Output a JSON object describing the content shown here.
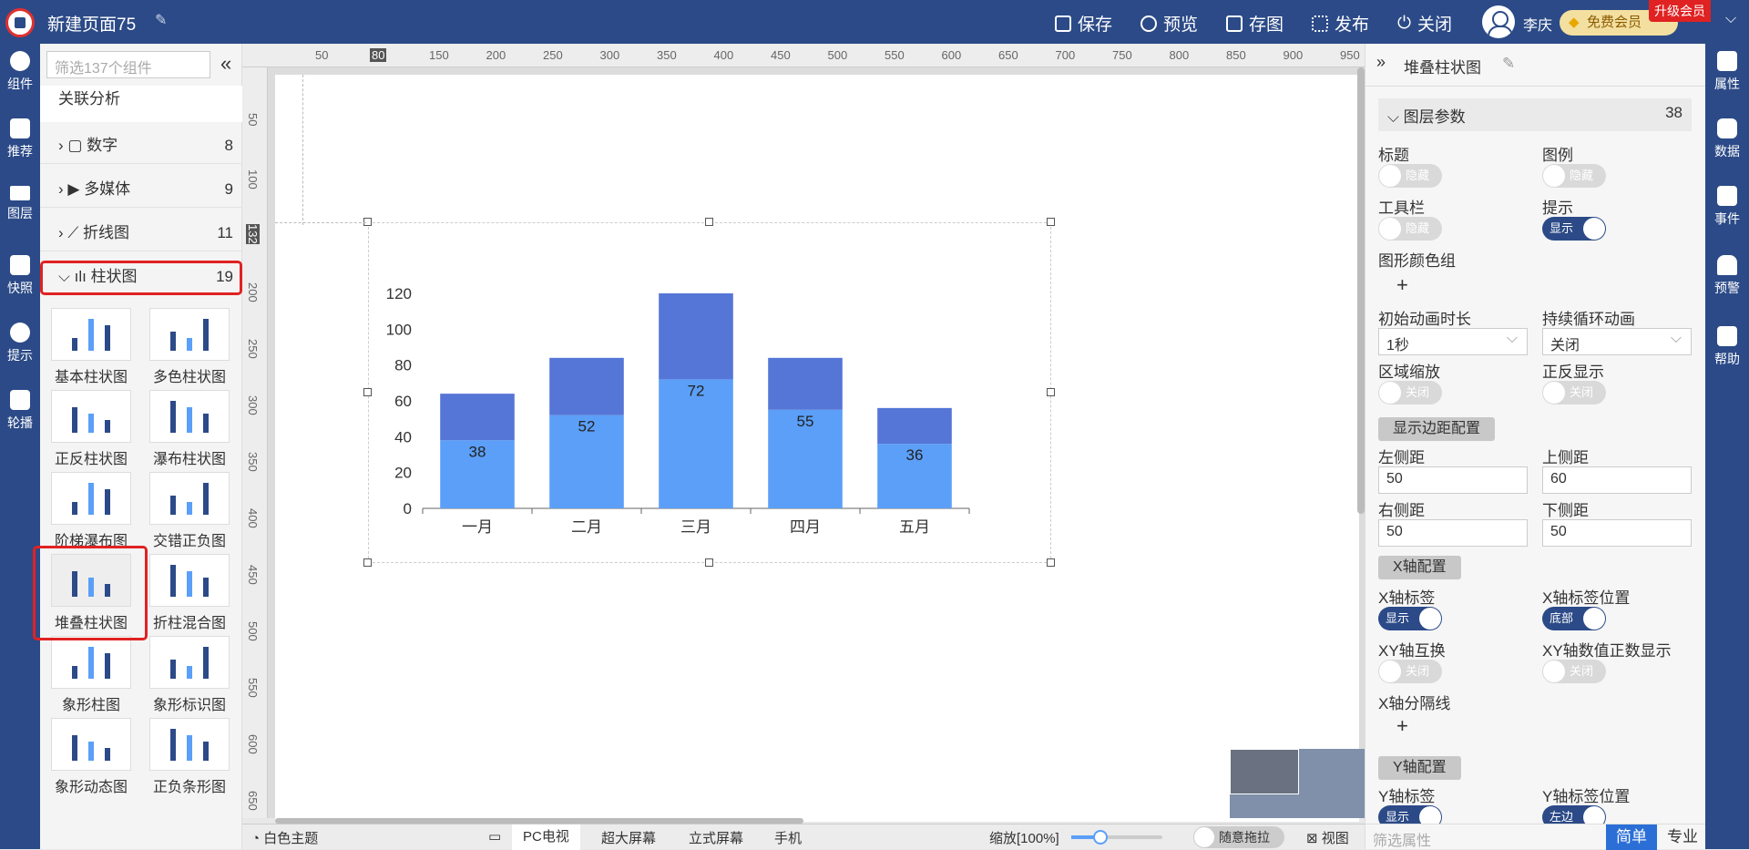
{
  "header": {
    "page_title": "新建页面75",
    "buttons": {
      "save": "保存",
      "preview": "预览",
      "save_image": "存图",
      "publish": "发布",
      "close": "关闭"
    },
    "user_name": "李庆",
    "member_label": "免费会员",
    "upgrade_label": "升级会员"
  },
  "left_nav": {
    "components": "组件",
    "recommend": "推荐",
    "layers": "图层",
    "snapshot": "快照",
    "tips": "提示",
    "carousel": "轮播"
  },
  "component_panel": {
    "search_placeholder": "筛选137个组件",
    "top_item": "关联分析",
    "categories": [
      {
        "label": "数字",
        "count": "8"
      },
      {
        "label": "多媒体",
        "count": "9"
      },
      {
        "label": "折线图",
        "count": "11"
      },
      {
        "label": "柱状图",
        "count": "19"
      }
    ],
    "items": [
      "基本柱状图",
      "多色柱状图",
      "正反柱状图",
      "瀑布柱状图",
      "阶梯瀑布图",
      "交错正负图",
      "堆叠柱状图",
      "折柱混合图",
      "象形柱图",
      "象形标识图",
      "象形动态图",
      "正负条形图"
    ]
  },
  "ruler": {
    "h_ticks": [
      "50",
      "80",
      "150",
      "200",
      "250",
      "300",
      "350",
      "400",
      "450",
      "500",
      "550",
      "600",
      "650",
      "700",
      "750",
      "800",
      "850",
      "900",
      "950"
    ],
    "v_ticks": [
      "50",
      "100",
      "132",
      "200",
      "250",
      "300",
      "350",
      "400",
      "450",
      "500",
      "550",
      "600",
      "650"
    ]
  },
  "chart_data": {
    "type": "bar",
    "stacked": true,
    "categories": [
      "一月",
      "二月",
      "三月",
      "四月",
      "五月"
    ],
    "series": [
      {
        "values": [
          38,
          52,
          72,
          55,
          36
        ],
        "color": "#5b9ff8",
        "labels_shown": true
      },
      {
        "values": [
          26,
          32,
          48,
          29,
          20
        ],
        "color": "#5576d6"
      }
    ],
    "ylim": [
      0,
      120
    ],
    "yticks": [
      "0",
      "20",
      "40",
      "60",
      "80",
      "100",
      "120"
    ],
    "title": "",
    "xlabel": "",
    "ylabel": "",
    "grid": false
  },
  "props_panel": {
    "title": "堆叠柱状图",
    "section_title": "图层参数",
    "section_count": "38",
    "labels": {
      "title": "标题",
      "legend": "图例",
      "toolbar": "工具栏",
      "tooltip": "提示",
      "color_group": "图形颜色组",
      "anim_duration": "初始动画时长",
      "loop_anim": "持续循环动画",
      "zoom": "区域缩放",
      "reverse": "正反显示",
      "margin_btn": "显示边距配置",
      "left": "左侧距",
      "top": "上侧距",
      "right": "右侧距",
      "bottom": "下侧距",
      "xaxis_btn": "X轴配置",
      "x_label": "X轴标签",
      "x_label_pos": "X轴标签位置",
      "xy_swap": "XY轴互换",
      "xy_positive": "XY轴数值正数显示",
      "x_split": "X轴分隔线",
      "yaxis_btn": "Y轴配置",
      "y_label": "Y轴标签",
      "y_label_pos": "Y轴标签位置"
    },
    "toggles": {
      "title": "隐藏",
      "legend": "隐藏",
      "toolbar": "隐藏",
      "tooltip": "显示",
      "zoom": "关闭",
      "reverse": "关闭",
      "x_label": "显示",
      "x_label_pos": "底部",
      "xy_swap": "关闭",
      "xy_positive": "关闭",
      "y_label": "显示",
      "y_label_pos": "左边"
    },
    "values": {
      "anim_duration": "1秒",
      "loop_anim": "关闭",
      "left": "50",
      "top": "60",
      "right": "50",
      "bottom": "50"
    },
    "filter_placeholder": "筛选属性",
    "mode_simple": "简单",
    "mode_pro": "专业"
  },
  "right_nav": {
    "props": "属性",
    "data": "数据",
    "events": "事件",
    "alert": "预警",
    "help": "帮助"
  },
  "bottom": {
    "theme": "白色主题",
    "pc": "PC电视",
    "large": "超大屏幕",
    "stereo": "立式屏幕",
    "phone": "手机",
    "zoom_label": "缩放[100%]",
    "drag_label": "随意拖拉",
    "view_label": "视图"
  }
}
